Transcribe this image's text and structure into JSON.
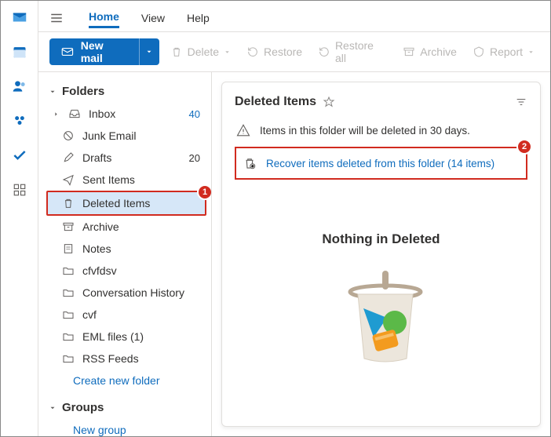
{
  "rail": {
    "apps": [
      "mail",
      "calendar",
      "people",
      "groups",
      "todo",
      "more"
    ]
  },
  "tabs": {
    "home": "Home",
    "view": "View",
    "help": "Help"
  },
  "toolbar": {
    "newmail": "New mail",
    "delete": "Delete",
    "restore": "Restore",
    "restore_all": "Restore all",
    "archive": "Archive",
    "report": "Report"
  },
  "nav": {
    "folders_head": "Folders",
    "items": [
      {
        "label": "Inbox",
        "count": "40"
      },
      {
        "label": "Junk Email"
      },
      {
        "label": "Drafts",
        "count": "20"
      },
      {
        "label": "Sent Items"
      },
      {
        "label": "Deleted Items"
      },
      {
        "label": "Archive"
      },
      {
        "label": "Notes"
      },
      {
        "label": "cfvfdsv"
      },
      {
        "label": "Conversation History"
      },
      {
        "label": "cvf"
      },
      {
        "label": "EML files (1)"
      },
      {
        "label": "RSS Feeds"
      }
    ],
    "create": "Create new folder",
    "groups_head": "Groups",
    "new_group": "New group"
  },
  "pane": {
    "title": "Deleted Items",
    "notice": "Items in this folder will be deleted in 30 days.",
    "recover": "Recover items deleted from this folder (14 items)",
    "empty": "Nothing in Deleted",
    "badge1": "1",
    "badge2": "2"
  }
}
